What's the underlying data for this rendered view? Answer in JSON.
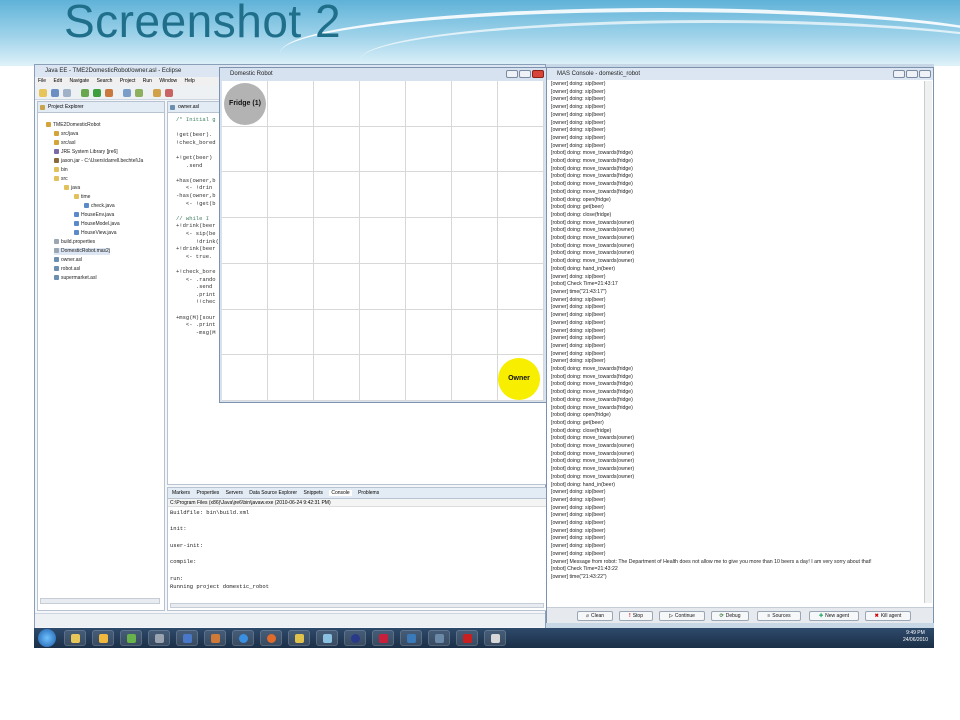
{
  "slide": {
    "title": "Screenshot 2"
  },
  "eclipse": {
    "title": "Java EE - TME2DomesticRobot/owner.asl - Eclipse",
    "menu": [
      "File",
      "Edit",
      "Navigate",
      "Search",
      "Project",
      "Run",
      "Window",
      "Help"
    ],
    "project_explorer_tab": "Project Explorer",
    "editor_tab": "owner.asl",
    "tree": [
      "TME2DomesticRobot",
      "src/java",
      "src/asl",
      "JRE System Library [jre6]",
      "jason.jar - C:\\Users\\darrell.bechtel\\Ja",
      "bin",
      "src",
      "java",
      "time",
      "check.java",
      "HouseEnv.java",
      "HouseModel.java",
      "HouseView.java",
      "build.properties",
      "DomesticRobot.mas2j",
      "owner.asl",
      "robot.asl",
      "supermarket.asl"
    ],
    "code": [
      "/* Initial g",
      "",
      "!get(beer).",
      "!check_bored",
      "",
      "+!get(beer)",
      "   .send",
      "",
      "+has(owner,b",
      "   <- !drin",
      "-has(owner,b",
      "   <- !get(b",
      "",
      "// while I",
      "+!drink(beer",
      "   <- sip(be",
      "      !drink(",
      "+!drink(beer",
      "   <- true.",
      "",
      "+!check_bore",
      "   <- .rando",
      "      .send",
      "      .print",
      "      !!chec",
      "",
      "+msg(M)[sour",
      "   <- .print",
      "      -msg(M"
    ],
    "console_tabs": [
      "Markers",
      "Properties",
      "Servers",
      "Data Source Explorer",
      "Snippets",
      "Console",
      "Problems"
    ],
    "console_path": "C:\\Program Files (x86)\\Java\\jre6\\bin\\javaw.exe (2010-06-24 9:42:31 PM)",
    "console_lines": [
      "Buildfile: bin\\build.xml",
      "",
      "init:",
      "",
      "user-init:",
      "",
      "compile:",
      "",
      "run:",
      "Running project domestic_robot"
    ]
  },
  "robot_window": {
    "title": "Domestic Robot",
    "fridge_label": "Fridge (1)",
    "owner_label": "Owner"
  },
  "mas_console": {
    "title": "MAS Console - domestic_robot",
    "log": [
      "[owner] doing: sip(beer)",
      "[owner] doing: sip(beer)",
      "[owner] doing: sip(beer)",
      "[owner] doing: sip(beer)",
      "[owner] doing: sip(beer)",
      "[owner] doing: sip(beer)",
      "[owner] doing: sip(beer)",
      "[owner] doing: sip(beer)",
      "[owner] doing: sip(beer)",
      "[robot] doing: move_towards(fridge)",
      "[robot] doing: move_towards(fridge)",
      "[robot] doing: move_towards(fridge)",
      "[robot] doing: move_towards(fridge)",
      "[robot] doing: move_towards(fridge)",
      "[robot] doing: move_towards(fridge)",
      "[robot] doing: open(fridge)",
      "[robot] doing: get(beer)",
      "[robot] doing: close(fridge)",
      "[robot] doing: move_towards(owner)",
      "[robot] doing: move_towards(owner)",
      "[robot] doing: move_towards(owner)",
      "[robot] doing: move_towards(owner)",
      "[robot] doing: move_towards(owner)",
      "[robot] doing: move_towards(owner)",
      "[robot] doing: hand_in(beer)",
      "[owner] doing: sip(beer)",
      "[robot] Check Time=21:43:17",
      "[owner] time(\"21:43:17\")",
      "[owner] doing: sip(beer)",
      "[owner] doing: sip(beer)",
      "[owner] doing: sip(beer)",
      "[owner] doing: sip(beer)",
      "[owner] doing: sip(beer)",
      "[owner] doing: sip(beer)",
      "[owner] doing: sip(beer)",
      "[owner] doing: sip(beer)",
      "[owner] doing: sip(beer)",
      "[robot] doing: move_towards(fridge)",
      "[robot] doing: move_towards(fridge)",
      "[robot] doing: move_towards(fridge)",
      "[robot] doing: move_towards(fridge)",
      "[robot] doing: move_towards(fridge)",
      "[robot] doing: move_towards(fridge)",
      "[robot] doing: open(fridge)",
      "[robot] doing: get(beer)",
      "[robot] doing: close(fridge)",
      "[robot] doing: move_towards(owner)",
      "[robot] doing: move_towards(owner)",
      "[robot] doing: move_towards(owner)",
      "[robot] doing: move_towards(owner)",
      "[robot] doing: move_towards(owner)",
      "[robot] doing: move_towards(owner)",
      "[robot] doing: hand_in(beer)",
      "[owner] doing: sip(beer)",
      "[owner] doing: sip(beer)",
      "[owner] doing: sip(beer)",
      "[owner] doing: sip(beer)",
      "[owner] doing: sip(beer)",
      "[owner] doing: sip(beer)",
      "[owner] doing: sip(beer)",
      "[owner] doing: sip(beer)",
      "[owner] doing: sip(beer)",
      "[owner] Message from robot: The Department of Health does not allow me to give you more than 10 beers a day! I am very sorry about that!",
      "[robot] Check Time=21:43:22",
      "[owner] time(\"21:43:22\")"
    ],
    "buttons": [
      "Clean",
      "Stop",
      "Continue",
      "Debug",
      "Sources",
      "New agent",
      "Kill agent"
    ]
  },
  "taskbar": {
    "time": "9:49 PM",
    "date": "24/06/2010"
  }
}
